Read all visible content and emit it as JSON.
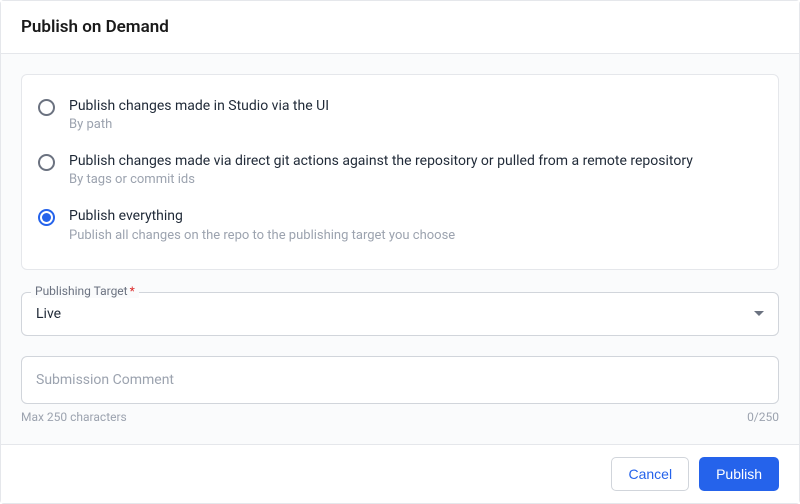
{
  "header": {
    "title": "Publish on Demand"
  },
  "options": [
    {
      "label": "Publish changes made in Studio via the UI",
      "sub": "By path",
      "selected": false
    },
    {
      "label": "Publish changes made via direct git actions against the repository or pulled from a remote repository",
      "sub": "By tags or commit ids",
      "selected": false
    },
    {
      "label": "Publish everything",
      "sub": "Publish all changes on the repo to the publishing target you choose",
      "selected": true
    }
  ],
  "target": {
    "label": "Publishing Target",
    "required": "*",
    "value": "Live"
  },
  "comment": {
    "placeholder": "Submission Comment",
    "max_label": "Max 250 characters",
    "counter": "0/250"
  },
  "footer": {
    "cancel": "Cancel",
    "publish": "Publish"
  }
}
